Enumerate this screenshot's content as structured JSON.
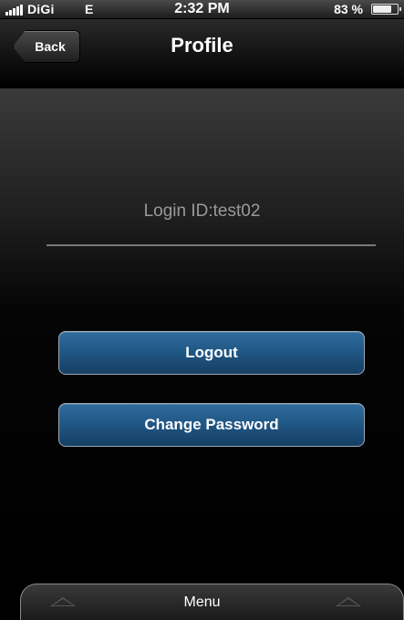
{
  "status_bar": {
    "carrier": "DiGi",
    "network": "E",
    "time": "2:32 PM",
    "battery_pct": "83 %",
    "battery_level": 0.83
  },
  "nav": {
    "back_label": "Back",
    "title": "Profile"
  },
  "profile": {
    "login_id": "Login ID:test02"
  },
  "actions": {
    "logout_label": "Logout",
    "change_password_label": "Change Password"
  },
  "bottom": {
    "menu_label": "Menu"
  },
  "colors": {
    "button_blue": "#1f5683",
    "login_text": "#9a9a9a"
  },
  "icons": [
    "signal-icon",
    "battery-icon",
    "chevron-up-icon"
  ]
}
